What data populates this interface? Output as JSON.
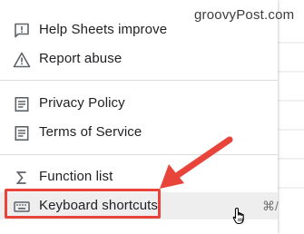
{
  "watermark": "groovyPost.com",
  "menu": {
    "items": [
      {
        "label": "Help Sheets improve",
        "icon": "feedback-icon"
      },
      {
        "label": "Report abuse",
        "icon": "warning-icon"
      },
      {
        "label": "Privacy Policy",
        "icon": "document-icon"
      },
      {
        "label": "Terms of Service",
        "icon": "document-icon"
      },
      {
        "label": "Function list",
        "icon": "sigma-icon"
      },
      {
        "label": "Keyboard shortcuts",
        "icon": "keyboard-icon",
        "shortcut": "⌘/",
        "highlighted": true
      }
    ]
  },
  "colors": {
    "annotation": "#e8443a",
    "text": "#202124",
    "icon": "#5f6368",
    "highlight_bg": "#eeeeee"
  }
}
